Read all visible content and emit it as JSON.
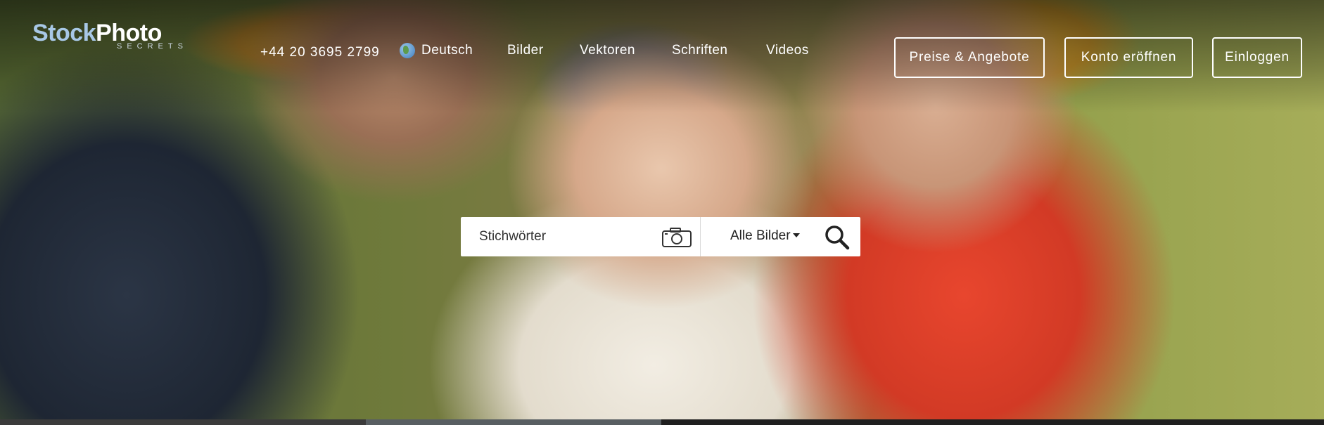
{
  "logo": {
    "main_stock": "Stock",
    "main_photo": "Photo",
    "sub": "SECRETS"
  },
  "header": {
    "phone": "+44 20 3695 2799",
    "language": "Deutsch",
    "nav": [
      "Bilder",
      "Vektoren",
      "Schriften",
      "Videos"
    ],
    "buttons": {
      "pricing": "Preise & Angebote",
      "signup": "Konto eröffnen",
      "login": "Einloggen"
    }
  },
  "search": {
    "placeholder": "Stichwörter",
    "filter_selected": "Alle Bilder",
    "icons": {
      "camera": "camera-icon",
      "search": "search-icon",
      "globe": "globe-icon"
    }
  },
  "colors": {
    "logo_accent": "#a8c8e6",
    "text": "#ffffff"
  }
}
